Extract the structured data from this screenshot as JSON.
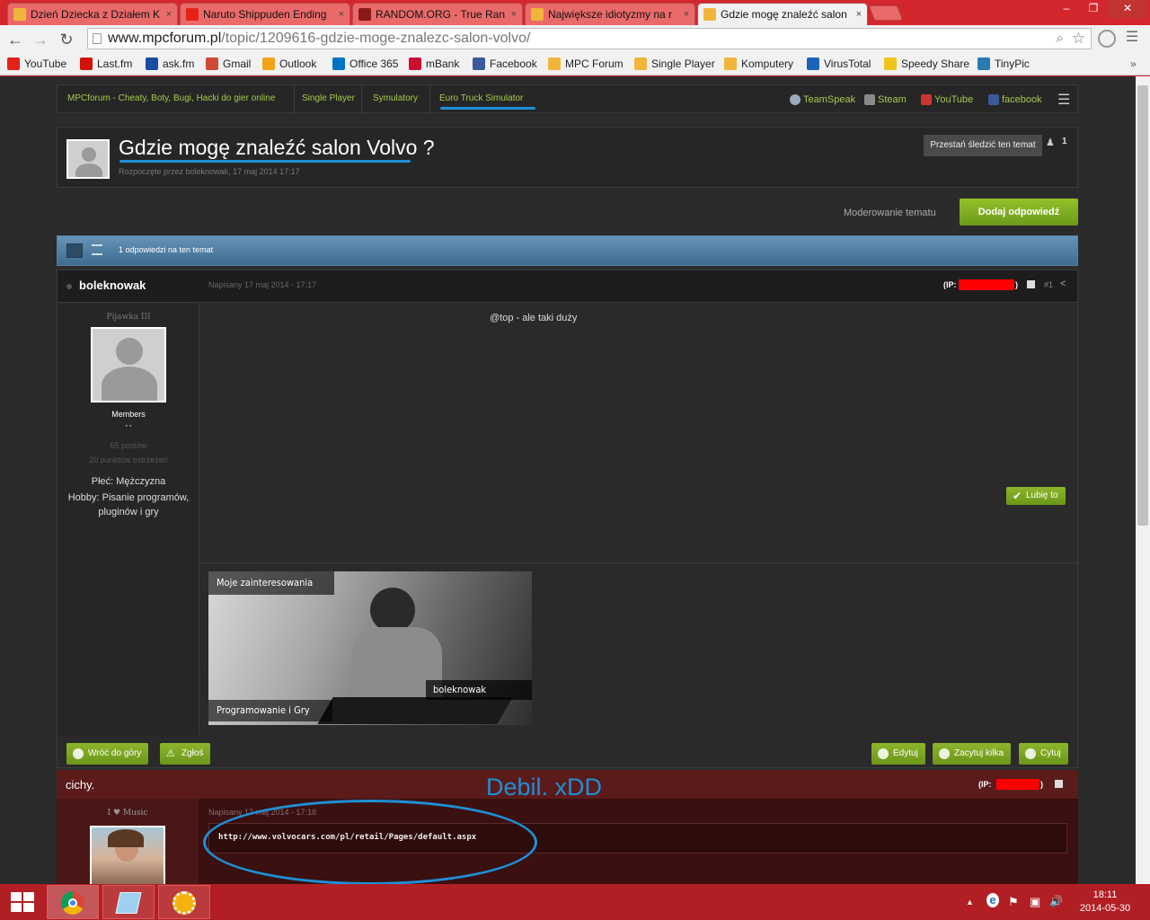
{
  "browser": {
    "tabs": [
      {
        "title": "Dzień Dziecka z Działem K",
        "favicon_color": "#f1b53a"
      },
      {
        "title": "Naruto Shippuden Ending",
        "favicon_color": "#e62117"
      },
      {
        "title": "RANDOM.ORG - True Ran",
        "favicon_color": "#8b1a1a"
      },
      {
        "title": "Największe idiotyzmy na r",
        "favicon_color": "#f1b53a"
      },
      {
        "title": "Gdzie mogę znaleźć salon",
        "favicon_color": "#f1b53a"
      }
    ],
    "tab_close": "×",
    "window_buttons": {
      "minimize": "–",
      "maximize": "❐",
      "close": "✕"
    },
    "nav": {
      "back": "←",
      "forward": "→",
      "reload": "↻"
    },
    "url_host": "www.mpcforum.pl",
    "url_path": "/topic/1209616-gdzie-moge-znalezc-salon-volvo/",
    "bookmarks": [
      {
        "label": "YouTube",
        "color": "#e62117"
      },
      {
        "label": "Last.fm",
        "color": "#d51007"
      },
      {
        "label": "ask.fm",
        "color": "#1a4da1"
      },
      {
        "label": "Gmail",
        "color": "#d14836"
      },
      {
        "label": "Outlook",
        "color": "#f3a21c"
      },
      {
        "label": "Office 365",
        "color": "#0072c6"
      },
      {
        "label": "mBank",
        "color": "#c8102e"
      },
      {
        "label": "Facebook",
        "color": "#3b5998"
      },
      {
        "label": "MPC Forum",
        "color": "#f1b53a"
      },
      {
        "label": "Single Player",
        "color": "#f1b53a"
      },
      {
        "label": "Komputery",
        "color": "#f1b53a"
      },
      {
        "label": "VirusTotal",
        "color": "#1c63b8"
      },
      {
        "label": "Speedy Share",
        "color": "#f0c419"
      },
      {
        "label": "TinyPic",
        "color": "#2a7ab0"
      }
    ]
  },
  "forum": {
    "breadcrumbs": [
      "MPCforum - Cheaty, Boty, Bugi, Hacki do gier online",
      "Single Player",
      "Symulatory",
      "Euro Truck Simulator"
    ],
    "user_links": [
      {
        "label": "TeamSpeak",
        "color": "#9ab"
      },
      {
        "label": "Steam",
        "color": "#888"
      },
      {
        "label": "YouTube",
        "color": "#c33"
      },
      {
        "label": "facebook",
        "color": "#3b5998"
      }
    ],
    "menu_icon": "☰",
    "topic_title": "Gdzie mogę znaleźć salon Volvo ?",
    "topic_started": "Rozpoczęte przez boleknowak, 17 maj 2014 17:17",
    "follow_button": "Przestań śledzić ten temat",
    "followers_count": "1",
    "moderate_label": "Moderowanie tematu",
    "reply_button": "Dodaj odpowiedź",
    "replies_label": "1 odpowiedzi na ten temat",
    "post1": {
      "author": "boleknowak",
      "posted": "Napisany 17 maj 2014 - 17:17",
      "ip_label": "(IP:",
      "ip_close": ")",
      "post_num": "#1",
      "rank": "Pijawka III",
      "group": "Members",
      "rank_dots": "▪ ▪",
      "posts": "65 postów",
      "warn": "20 punktów ostrzeżeń",
      "gender": "Płeć: Mężczyzna",
      "hobby": "Hobby: Pisanie programów, pluginów i gry",
      "content": "@top - ale taki duży",
      "like_button": "Lubię to",
      "sig_title": "Moje zainteresowania",
      "sig_name": "boleknowak",
      "sig_sub": "Programowanie i Gry",
      "btn_top": "Wróć do góry",
      "btn_report": "Zgłoś",
      "btn_edit": "Edytuj",
      "btn_multiquote": "Zacytuj kilka",
      "btn_quote": "Cytuj"
    },
    "post2": {
      "author": "cichy.",
      "ip_label": "(IP:",
      "ip_close": ")",
      "rank": "I ♥ Music",
      "posted": "Napisany 17 maj 2014 - 17:18",
      "link": "http://www.volvocars.com/pl/retail/Pages/default.aspx"
    },
    "annotation": "Debil. xDD"
  },
  "taskbar": {
    "clock_time": "18:11",
    "clock_date": "2014-05-30",
    "tray_up": "▲",
    "tray_ie": "e",
    "tray_flag": "⚑",
    "tray_net": "▣",
    "tray_vol": "🔊"
  },
  "colors": {
    "accent_green": "#a6c94b",
    "browser_frame": "#d3272d",
    "annotation_blue": "#1e90d6"
  }
}
